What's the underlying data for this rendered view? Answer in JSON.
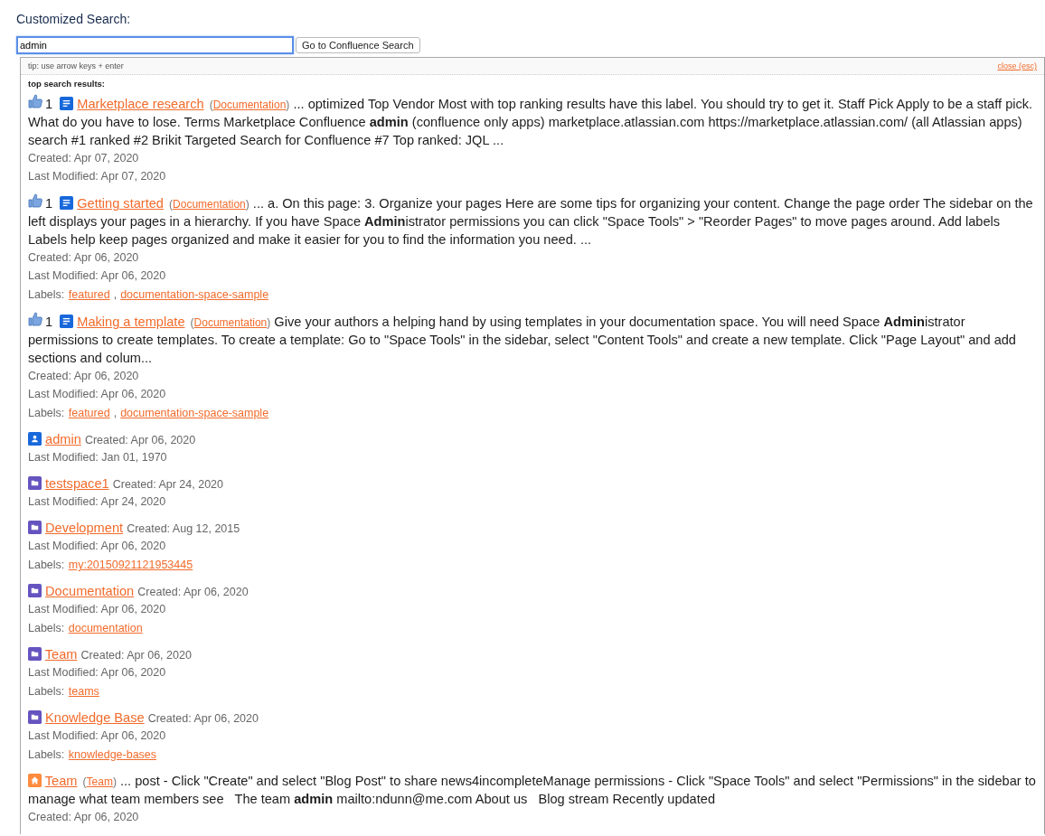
{
  "heading": "Customized Search:",
  "search": {
    "value": "admin",
    "focused": true
  },
  "search_button": "Go to Confluence Search",
  "popup": {
    "tip": "tip: use arrow keys + enter",
    "close": "close (esc)",
    "section_title": "top search results:",
    "results": [
      {
        "kind": "page",
        "likes": "1",
        "title": "Marketplace research",
        "brackets": [
          "(",
          ")"
        ],
        "space": "Documentation",
        "excerpt": "... optimized Top Vendor Most with top ranking results have this label. You should try to get it. Staff Pick Apply to be a staff pick. What do you have to lose. Terms Marketplace Confluence **admin** (confluence only apps) marketplace.atlassian.com https://marketplace.atlassian.com/ (all Atlassian apps) search #1 ranked #2 Brikit Targeted Search for Confluence #7 Top ranked: JQL ...",
        "meta": [
          "Created: Apr 07, 2020",
          "Last Modified: Apr 07, 2020"
        ]
      },
      {
        "kind": "page",
        "likes": "1",
        "title": "Getting started",
        "brackets": [
          "(",
          ")"
        ],
        "space": "Documentation",
        "excerpt": "... a. On this page: 3. Organize your pages Here are some tips for organizing your content. Change the page order The sidebar on the left displays your pages in a hierarchy. If you have Space **Admin**istrator permissions you can click \"Space Tools\" > \"Reorder Pages\" to move pages around. Add labels Labels help keep pages organized and make it easier for you to find the information you need. ...",
        "meta": [
          "Created: Apr 06, 2020",
          "Last Modified: Apr 06, 2020"
        ],
        "labels_caption": "Labels:",
        "labels": [
          "featured",
          "documentation-space-sample"
        ],
        "separator": ","
      },
      {
        "kind": "page",
        "likes": "1",
        "title": "Making a template",
        "brackets": [
          "(",
          ")"
        ],
        "space": "Documentation",
        "excerpt": "Give your authors a helping hand by using templates in your documentation space. You will need Space **Admin**istrator permissions to create templates. To create a template: Go to \"Space Tools\" in the sidebar, select \"Content Tools\" and create a new template. Click \"Page Layout\" and add sections and colum...",
        "meta": [
          "Created: Apr 06, 2020",
          "Last Modified: Apr 06, 2020"
        ],
        "labels_caption": "Labels:",
        "labels": [
          "featured",
          "documentation-space-sample"
        ],
        "separator": ","
      },
      {
        "kind": "user",
        "title": "admin",
        "created": "Created: Apr 06, 2020",
        "meta": [
          "Last Modified: Jan 01, 1970"
        ]
      },
      {
        "kind": "space",
        "title": "testspace1",
        "created": "Created: Apr 24, 2020",
        "meta": [
          "Last Modified: Apr 24, 2020"
        ]
      },
      {
        "kind": "space",
        "title": "Development",
        "created": "Created: Aug 12, 2015",
        "meta": [
          "Last Modified: Apr 06, 2020"
        ],
        "labels_caption": "Labels:",
        "labels": [
          "my:20150921121953445"
        ]
      },
      {
        "kind": "space",
        "title": "Documentation",
        "created": "Created: Apr 06, 2020",
        "meta": [
          "Last Modified: Apr 06, 2020"
        ],
        "labels_caption": "Labels:",
        "labels": [
          "documentation"
        ]
      },
      {
        "kind": "space",
        "title": "Team",
        "created": "Created: Apr 06, 2020",
        "meta": [
          "Last Modified: Apr 06, 2020"
        ],
        "labels_caption": "Labels:",
        "labels": [
          "teams"
        ]
      },
      {
        "kind": "space",
        "title": "Knowledge Base",
        "created": "Created: Apr 06, 2020",
        "meta": [
          "Last Modified: Apr 06, 2020"
        ],
        "labels_caption": "Labels:",
        "labels": [
          "knowledge-bases"
        ]
      },
      {
        "kind": "blog",
        "title": "Team",
        "brackets": [
          "(",
          ")"
        ],
        "space": "Team",
        "excerpt": "... post - Click \"Create\" and select \"Blog Post\" to share news4incompleteManage permissions - Click \"Space Tools\" and select \"Permissions\" in the sidebar to manage what team members see   The team **admin** mailto:ndunn@me.com About us   Blog stream Recently updated",
        "meta": [
          "Created: Apr 06, 2020"
        ]
      }
    ]
  }
}
